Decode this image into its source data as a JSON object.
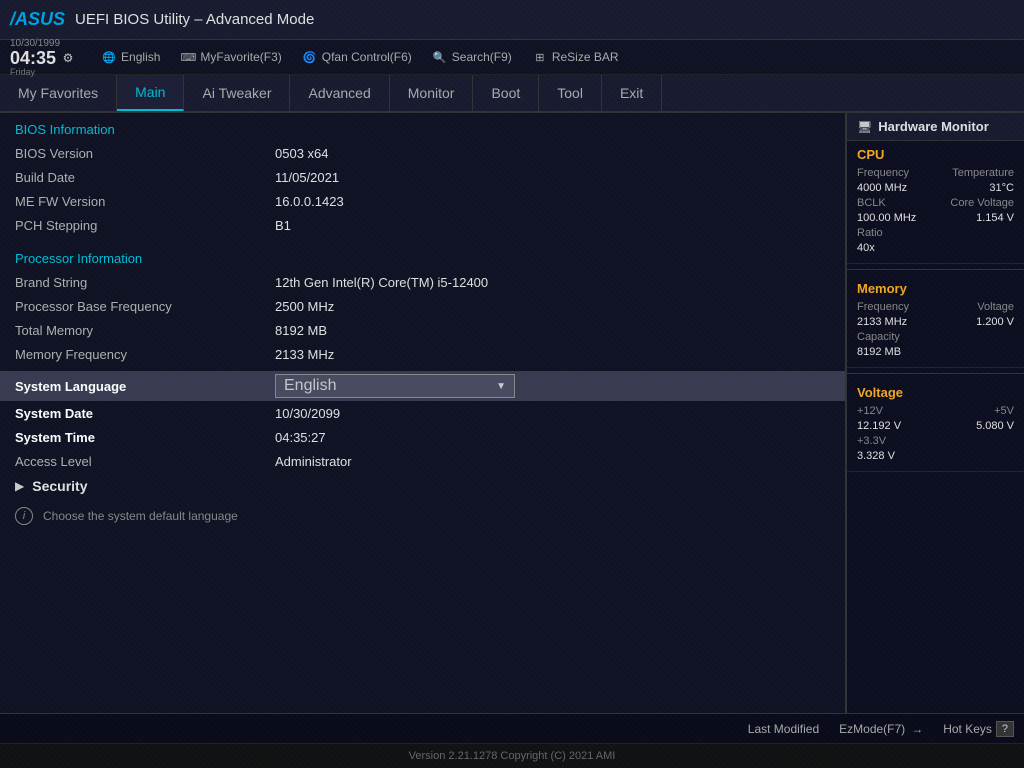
{
  "header": {
    "logo": "/ASUS",
    "title": "UEFI BIOS Utility – Advanced Mode"
  },
  "toolbar": {
    "date": "10/30/1999",
    "day": "Friday",
    "time": "04:35",
    "gear_icon": "⚙",
    "lang_label": "English",
    "myfavorite_label": "MyFavorite(F3)",
    "qfan_label": "Qfan Control(F6)",
    "search_label": "Search(F9)",
    "resize_label": "ReSize BAR"
  },
  "nav": {
    "tabs": [
      {
        "id": "my-favorites",
        "label": "My Favorites",
        "active": false
      },
      {
        "id": "main",
        "label": "Main",
        "active": true
      },
      {
        "id": "ai-tweaker",
        "label": "Ai Tweaker",
        "active": false
      },
      {
        "id": "advanced",
        "label": "Advanced",
        "active": false
      },
      {
        "id": "monitor",
        "label": "Monitor",
        "active": false
      },
      {
        "id": "boot",
        "label": "Boot",
        "active": false
      },
      {
        "id": "tool",
        "label": "Tool",
        "active": false
      },
      {
        "id": "exit",
        "label": "Exit",
        "active": false
      }
    ]
  },
  "bios_info": {
    "section_title": "BIOS Information",
    "bios_version_label": "BIOS Version",
    "bios_version_value": "0503  x64",
    "build_date_label": "Build Date",
    "build_date_value": "11/05/2021",
    "me_fw_label": "ME FW Version",
    "me_fw_value": "16.0.0.1423",
    "pch_stepping_label": "PCH Stepping",
    "pch_stepping_value": "B1"
  },
  "processor_info": {
    "section_title": "Processor Information",
    "brand_string_label": "Brand String",
    "brand_string_value": "12th Gen Intel(R) Core(TM) i5-12400",
    "base_freq_label": "Processor Base Frequency",
    "base_freq_value": "2500 MHz",
    "total_memory_label": "Total Memory",
    "total_memory_value": "8192 MB",
    "memory_freq_label": "Memory Frequency",
    "memory_freq_value": "2133 MHz"
  },
  "system": {
    "language_label": "System Language",
    "language_value": "English",
    "date_label": "System Date",
    "date_value": "10/30/2099",
    "time_label": "System Time",
    "time_value": "04:35:27",
    "access_level_label": "Access Level",
    "access_level_value": "Administrator"
  },
  "security": {
    "label": "Security"
  },
  "bottom_hint": "Choose the system default language",
  "hardware_monitor": {
    "title": "Hardware Monitor",
    "cpu": {
      "title": "CPU",
      "frequency_label": "Frequency",
      "frequency_value": "4000 MHz",
      "temperature_label": "Temperature",
      "temperature_value": "31°C",
      "bclk_label": "BCLK",
      "bclk_value": "100.00 MHz",
      "core_voltage_label": "Core Voltage",
      "core_voltage_value": "1.154 V",
      "ratio_label": "Ratio",
      "ratio_value": "40x"
    },
    "memory": {
      "title": "Memory",
      "frequency_label": "Frequency",
      "frequency_value": "2133 MHz",
      "voltage_label": "Voltage",
      "voltage_value": "1.200 V",
      "capacity_label": "Capacity",
      "capacity_value": "8192 MB"
    },
    "voltage": {
      "title": "Voltage",
      "plus12v_label": "+12V",
      "plus12v_value": "12.192 V",
      "plus5v_label": "+5V",
      "plus5v_value": "5.080 V",
      "plus33v_label": "+3.3V",
      "plus33v_value": "3.328 V"
    }
  },
  "footer": {
    "last_modified": "Last Modified",
    "ez_mode_label": "EzMode(F7)",
    "hot_keys_label": "Hot Keys"
  },
  "copyright": "Version 2.21.1278 Copyright (C) 2021 AMI"
}
